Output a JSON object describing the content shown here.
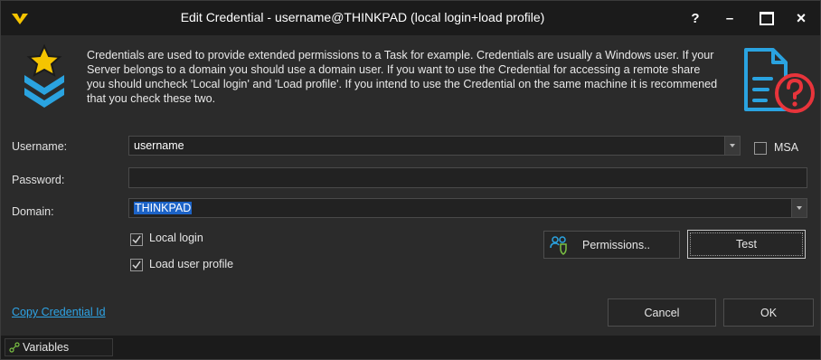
{
  "window": {
    "title": "Edit Credential - username@THINKPAD (local login+load profile)",
    "help_label": "?",
    "minimize_label": "–",
    "close_label": "×"
  },
  "description": "Credentials are used to provide extended permissions to a Task for example. Credentials are usually a Windows user. If your Server belongs to a domain you should use a domain user. If you want to use the Credential for accessing a remote share you should uncheck 'Local login' and 'Load profile'. If you intend to use the Credential on the same machine it is recommened that you check these two.",
  "form": {
    "username_label": "Username:",
    "username_value": "username",
    "msa_label": "MSA",
    "msa_checked": false,
    "password_label": "Password:",
    "password_value": "",
    "domain_label": "Domain:",
    "domain_value": "THINKPAD",
    "local_login_label": "Local login",
    "local_login_checked": true,
    "load_profile_label": "Load user profile",
    "load_profile_checked": true
  },
  "buttons": {
    "permissions": "Permissions..",
    "test": "Test",
    "cancel": "Cancel",
    "ok": "OK"
  },
  "link": {
    "copy_credential_id": "Copy Credential Id"
  },
  "statusbar": {
    "variables_label": "Variables"
  },
  "colors": {
    "accent_yellow": "#f5c400",
    "accent_blue": "#2aa3e0",
    "accent_red": "#e8343b",
    "link": "#2ea4e6",
    "selection": "#1c63c7"
  },
  "icons": {
    "app": "app-logo-icon",
    "badge": "badge-star-chevron-icon",
    "doc_help": "document-help-icon",
    "permissions": "users-shield-icon",
    "variables": "variables-icon"
  }
}
